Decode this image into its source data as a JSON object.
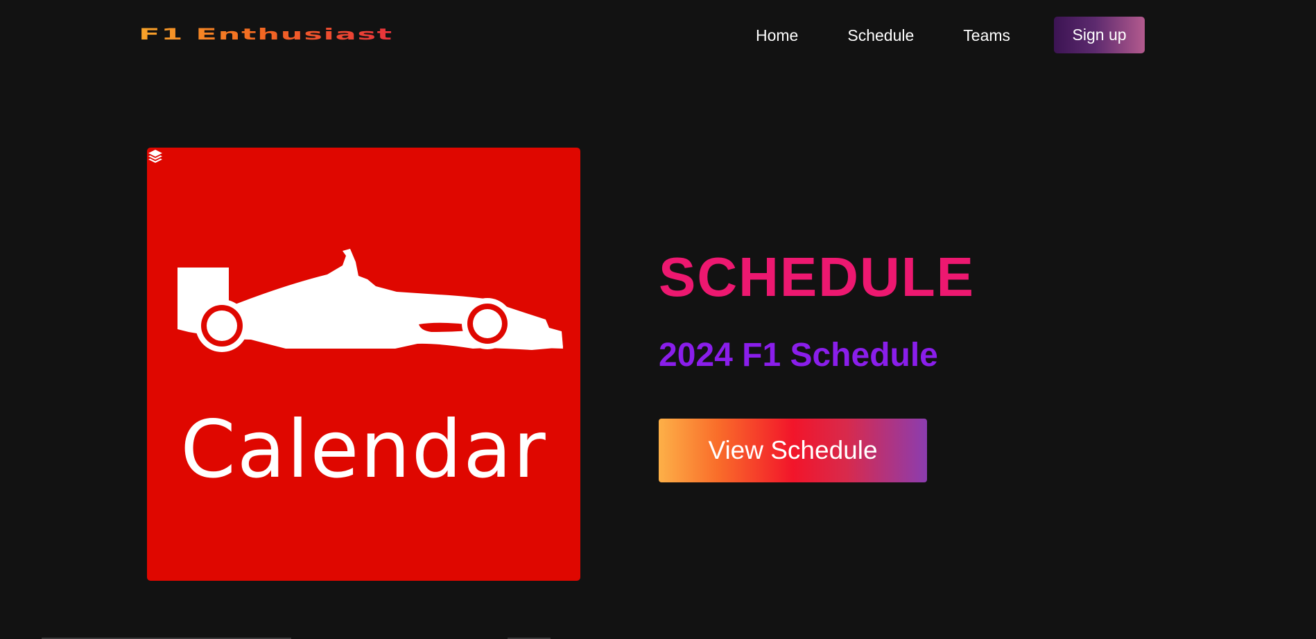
{
  "navbar": {
    "logo": "F1 Enthusiast",
    "links": [
      "Home",
      "Schedule",
      "Teams"
    ],
    "signup_label": "Sign up"
  },
  "hero": {
    "image_caption": "Calendar",
    "image_icon": "layers-icon",
    "title": "SCHEDULE",
    "subtitle": "2024 F1 Schedule",
    "cta_label": "View Schedule"
  },
  "colors": {
    "background": "#121212",
    "image_red": "#df0700",
    "title_pink": "#ed1870",
    "subtitle_purple": "#8a1eeb",
    "signup_gradient": [
      "#3c1453",
      "#b35a8e"
    ],
    "cta_gradient": [
      "#fdb048",
      "#f2152a",
      "#8b3db0"
    ],
    "logo_gradient": [
      "#f7a42a",
      "#e8333c"
    ]
  }
}
